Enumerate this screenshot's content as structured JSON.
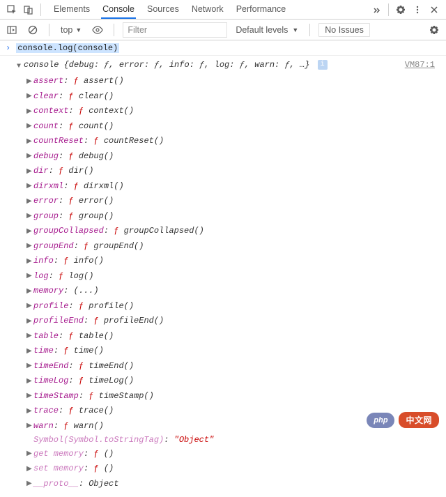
{
  "tabs": {
    "elements": "Elements",
    "console": "Console",
    "sources": "Sources",
    "network": "Network",
    "performance": "Performance"
  },
  "toolbar2": {
    "context": "top",
    "filter_placeholder": "Filter",
    "levels": "Default levels",
    "no_issues": "No Issues"
  },
  "prompt": {
    "command": "console.log(console)"
  },
  "result": {
    "head": "console {debug: ƒ, error: ƒ, info: ƒ, log: ƒ, warn: ƒ, …}",
    "source": "VM87:1",
    "props": [
      {
        "key": "assert",
        "func": "assert()"
      },
      {
        "key": "clear",
        "func": "clear()"
      },
      {
        "key": "context",
        "func": "context()"
      },
      {
        "key": "count",
        "func": "count()"
      },
      {
        "key": "countReset",
        "func": "countReset()"
      },
      {
        "key": "debug",
        "func": "debug()"
      },
      {
        "key": "dir",
        "func": "dir()"
      },
      {
        "key": "dirxml",
        "func": "dirxml()"
      },
      {
        "key": "error",
        "func": "error()"
      },
      {
        "key": "group",
        "func": "group()"
      },
      {
        "key": "groupCollapsed",
        "func": "groupCollapsed()"
      },
      {
        "key": "groupEnd",
        "func": "groupEnd()"
      },
      {
        "key": "info",
        "func": "info()"
      },
      {
        "key": "log",
        "func": "log()"
      },
      {
        "key": "memory",
        "plain": "(...)"
      },
      {
        "key": "profile",
        "func": "profile()"
      },
      {
        "key": "profileEnd",
        "func": "profileEnd()"
      },
      {
        "key": "table",
        "func": "table()"
      },
      {
        "key": "time",
        "func": "time()"
      },
      {
        "key": "timeEnd",
        "func": "timeEnd()"
      },
      {
        "key": "timeLog",
        "func": "timeLog()"
      },
      {
        "key": "timeStamp",
        "func": "timeStamp()"
      },
      {
        "key": "trace",
        "func": "trace()"
      },
      {
        "key": "warn",
        "func": "warn()"
      },
      {
        "key": "Symbol(Symbol.toStringTag)",
        "str": "\"Object\"",
        "dim": true,
        "noTri": true
      },
      {
        "key": "get memory",
        "func": "()",
        "dim": true
      },
      {
        "key": "set memory",
        "func": "()",
        "dim": true
      },
      {
        "key": "__proto__",
        "plain": "Object",
        "dim": true
      }
    ]
  },
  "watermark": {
    "logo": "php",
    "text": "中文网"
  }
}
